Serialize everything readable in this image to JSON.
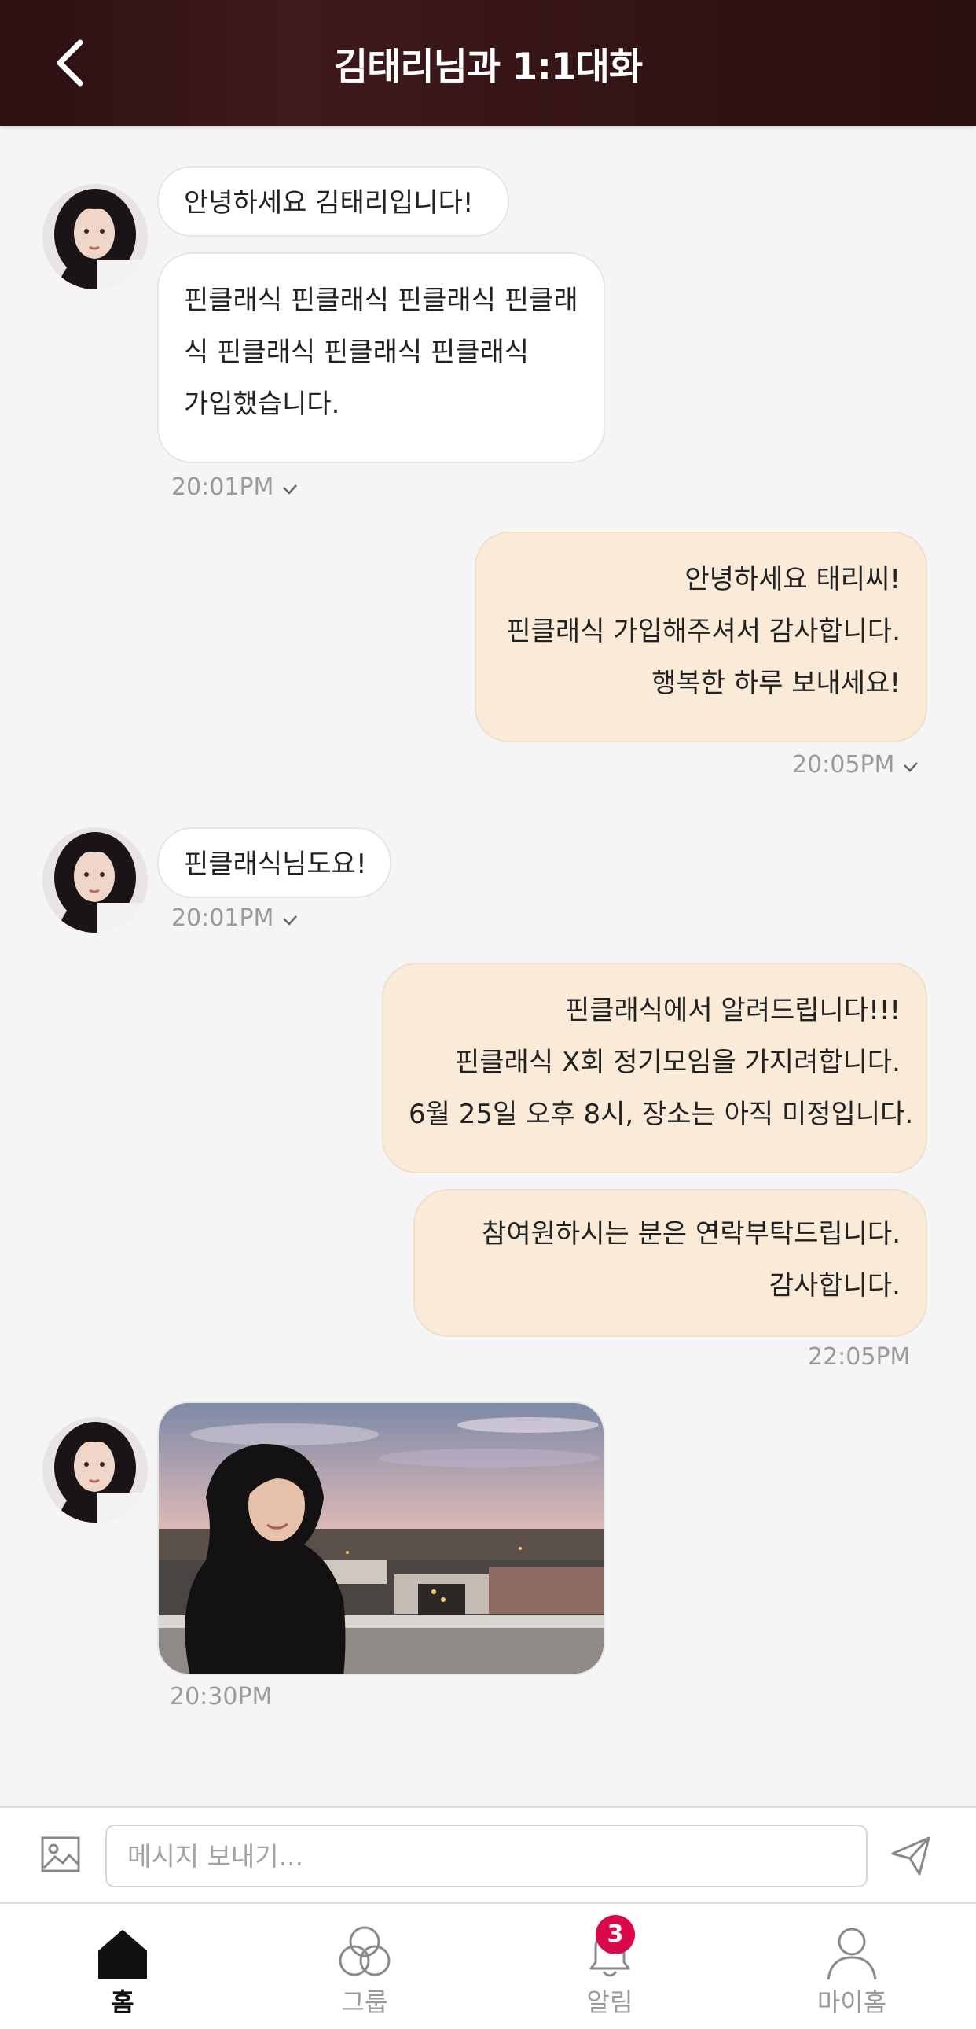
{
  "header": {
    "title": "김태리님과 1:1대화"
  },
  "messages": [
    {
      "lines": [
        "안녕하세요 김태리입니다!"
      ]
    },
    {
      "lines": [
        "핀클래식 핀클래식 핀클래식 핀클래",
        "식 핀클래식 핀클래식 핀클래식",
        "가입했습니다."
      ],
      "time": "20:01PM"
    },
    {
      "lines": [
        "안녕하세요 태리씨!",
        "핀클래식 가입해주셔서 감사합니다.",
        "행복한 하루 보내세요!"
      ],
      "time": "20:05PM"
    },
    {
      "lines": [
        "핀클래식님도요!"
      ],
      "time": "20:01PM"
    },
    {
      "lines": [
        "핀클래식에서 알려드립니다!!!",
        "핀클래식 X회 정기모임을 가지려합니다.",
        "6월 25일 오후 8시, 장소는 아직 미정입니다."
      ]
    },
    {
      "lines": [
        "참여원하시는 분은 연락부탁드립니다.",
        "감사합니다."
      ],
      "time": "22:05PM"
    },
    {
      "time": "20:30PM"
    }
  ],
  "input": {
    "placeholder": "메시지 보내기..."
  },
  "tabs": [
    {
      "label": "홈",
      "icon": "home-icon",
      "active": true
    },
    {
      "label": "그룹",
      "icon": "group-icon"
    },
    {
      "label": "알림",
      "icon": "bell-icon",
      "badge": "3"
    },
    {
      "label": "마이홈",
      "icon": "user-icon"
    }
  ],
  "colors": {
    "header": "#3a1718",
    "incoming_bubble": "#ffffff",
    "outgoing_bubble": "#faebd9",
    "badge": "#d90a4a",
    "background": "#f5f5f6"
  }
}
